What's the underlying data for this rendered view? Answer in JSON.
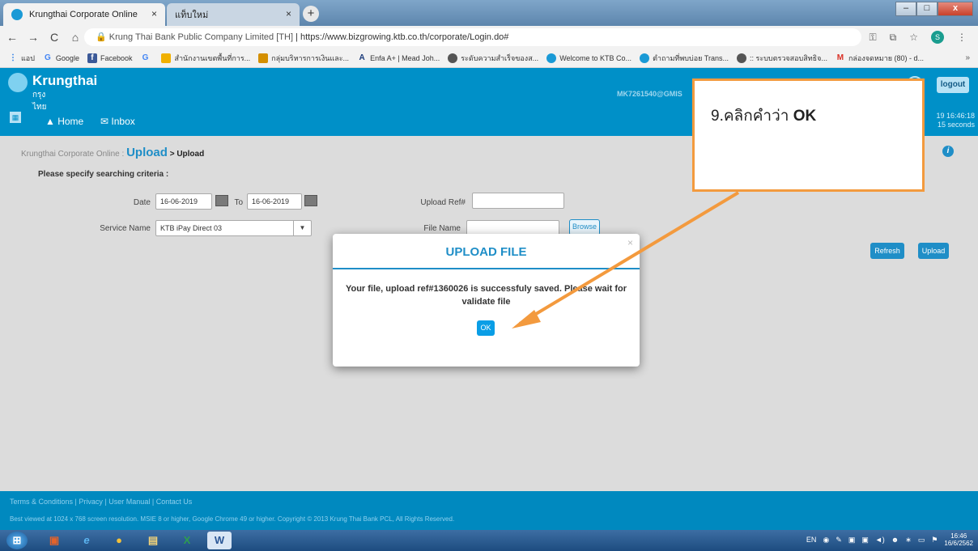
{
  "browser": {
    "tabs": [
      {
        "label": "Krungthai Corporate Online",
        "close": "×"
      },
      {
        "label": "แท็บใหม่",
        "close": "×"
      }
    ],
    "new_tab": "+",
    "window_controls": {
      "minimize": "–",
      "maximize": "□",
      "close": "x"
    },
    "address": {
      "site_name": "Krung Thai Bank Public Company Limited [TH]",
      "separator": "|",
      "url": "https://www.bizgrowing.ktb.co.th/corporate/Login.do#"
    },
    "profile_initial": "S",
    "bookmarks": [
      {
        "label": "แอป",
        "icon": "apps-icon"
      },
      {
        "label": "Google",
        "icon": "google-icon"
      },
      {
        "label": "Facebook",
        "icon": "facebook-icon"
      },
      {
        "label": "",
        "icon": "google-icon"
      },
      {
        "label": "สำนักงานเขตพื้นที่การ...",
        "icon": "site-icon"
      },
      {
        "label": "กลุ่มบริหารการเงินและ...",
        "icon": "site-icon"
      },
      {
        "label": "Enfa A+ | Mead Joh...",
        "icon": "enfa-icon"
      },
      {
        "label": "ระดับความสำเร็จของส...",
        "icon": "globe-icon"
      },
      {
        "label": "Welcome to KTB Co...",
        "icon": "ktb-icon"
      },
      {
        "label": "ตำถามที่พบบ่อย Trans...",
        "icon": "ktb-icon"
      },
      {
        "label": ":: ระบบตรวจสอบสิทธิจ...",
        "icon": "globe-icon"
      },
      {
        "label": "กล่องจดหมาย (80) - d...",
        "icon": "gmail-icon"
      }
    ],
    "bookmarks_more": "»"
  },
  "app": {
    "brand": "Krungthai",
    "brand_thai": "กรุงไทย",
    "user_code": "MK7261540@GMIS",
    "logout": "logout",
    "nav": {
      "home": "Home",
      "inbox": "Inbox"
    },
    "clock_line1": "19 16:46:18",
    "clock_line2": "15 seconds"
  },
  "page": {
    "breadcrumb_prefix": "Krungthai Corporate Online :",
    "breadcrumb_section": "Upload",
    "breadcrumb_current": "> Upload",
    "criteria_title": "Please specify searching criteria :",
    "date_label": "Date",
    "date_from": "16-06-2019",
    "to_label": "To",
    "date_to": "16-06-2019",
    "upload_ref_label": "Upload Ref#",
    "upload_ref_value": "",
    "service_label": "Service Name",
    "service_value": "KTB iPay Direct 03",
    "file_name_label": "File Name",
    "file_name_value": "",
    "browse": "Browse",
    "refresh": "Refresh",
    "upload": "Upload"
  },
  "modal": {
    "title": "UPLOAD FILE",
    "close": "×",
    "message": "Your file, upload ref#1360026 is successfuly saved. Please wait for validate file",
    "ok": "OK"
  },
  "annotation": {
    "text": "9.คลิกคำว่า",
    "emphasis": "OK",
    "color": "#f39a3e"
  },
  "footer": {
    "links": [
      "Terms & Conditions",
      "Privacy",
      "User Manual",
      "Contact Us"
    ],
    "separator": "|",
    "copyright": "Best viewed at 1024 x 768 screen resolution. MSIE 8 or higher, Google Chrome 49 or higher. Copyright © 2013 Krung Thai Bank PCL, All Rights Reserved."
  },
  "taskbar": {
    "lang": "EN",
    "time": "16:46",
    "date": "16/6/2562"
  }
}
